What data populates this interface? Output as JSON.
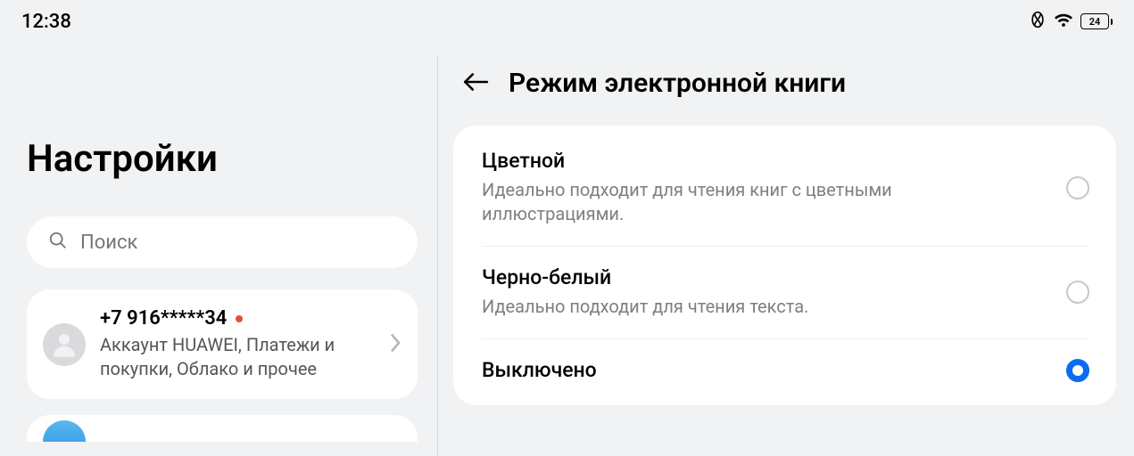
{
  "status": {
    "time": "12:38",
    "battery": "24"
  },
  "left_panel": {
    "title": "Настройки",
    "search_placeholder": "Поиск",
    "account": {
      "phone": "+7 916*****34",
      "subtitle": "Аккаунт HUAWEI, Платежи и покупки, Облако и прочее"
    }
  },
  "right_panel": {
    "title": "Режим электронной книги",
    "options": [
      {
        "title": "Цветной",
        "subtitle": "Идеально подходит для чтения книг с цветными иллюстрациями.",
        "selected": false
      },
      {
        "title": "Черно-белый",
        "subtitle": "Идеально подходит для чтения текста.",
        "selected": false
      },
      {
        "title": "Выключено",
        "subtitle": "",
        "selected": true
      }
    ]
  }
}
